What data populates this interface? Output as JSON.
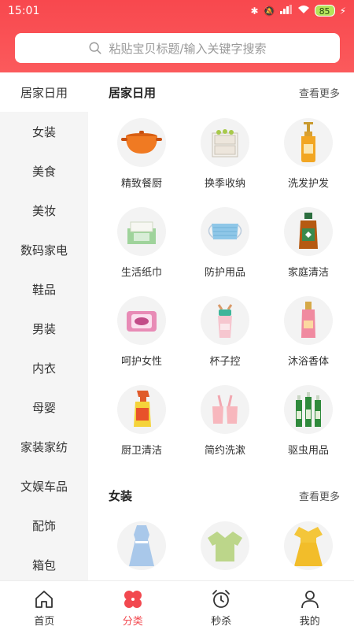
{
  "status_bar": {
    "time": "15:01",
    "battery": "85"
  },
  "search": {
    "placeholder": "粘贴宝贝标题/输入关键字搜索"
  },
  "sidebar": {
    "items": [
      {
        "label": "居家日用",
        "active": true
      },
      {
        "label": "女装"
      },
      {
        "label": "美食"
      },
      {
        "label": "美妆"
      },
      {
        "label": "数码家电"
      },
      {
        "label": "鞋品"
      },
      {
        "label": "男装"
      },
      {
        "label": "内衣"
      },
      {
        "label": "母婴"
      },
      {
        "label": "家装家纺"
      },
      {
        "label": "文娱车品"
      },
      {
        "label": "配饰"
      },
      {
        "label": "箱包"
      }
    ]
  },
  "sections": [
    {
      "title": "居家日用",
      "more": "查看更多",
      "items": [
        {
          "label": "精致餐厨",
          "icon": "cookware-icon"
        },
        {
          "label": "换季收纳",
          "icon": "storage-drawer-icon"
        },
        {
          "label": "洗发护发",
          "icon": "shampoo-icon"
        },
        {
          "label": "生活纸巾",
          "icon": "tissue-icon"
        },
        {
          "label": "防护用品",
          "icon": "mask-icon"
        },
        {
          "label": "家庭清洁",
          "icon": "disinfectant-icon"
        },
        {
          "label": "呵护女性",
          "icon": "sanitary-pad-icon"
        },
        {
          "label": "杯子控",
          "icon": "cup-icon"
        },
        {
          "label": "沐浴香体",
          "icon": "body-mist-icon"
        },
        {
          "label": "厨卫清洁",
          "icon": "spray-cleaner-icon"
        },
        {
          "label": "简约洗漱",
          "icon": "toothbrush-cup-icon"
        },
        {
          "label": "驱虫用品",
          "icon": "insect-repellent-icon"
        }
      ]
    },
    {
      "title": "女装",
      "more": "查看更多",
      "items": [
        {
          "label": "",
          "icon": "dress-blue-icon"
        },
        {
          "label": "",
          "icon": "shirt-green-icon"
        },
        {
          "label": "",
          "icon": "dress-yellow-icon"
        }
      ]
    }
  ],
  "bottom_nav": [
    {
      "label": "首页",
      "icon": "home-icon"
    },
    {
      "label": "分类",
      "icon": "category-icon",
      "active": true
    },
    {
      "label": "秒杀",
      "icon": "alarm-clock-icon"
    },
    {
      "label": "我的",
      "icon": "user-icon"
    }
  ],
  "colors": {
    "brand": "#f8484e",
    "active_text": "#f2484f"
  }
}
